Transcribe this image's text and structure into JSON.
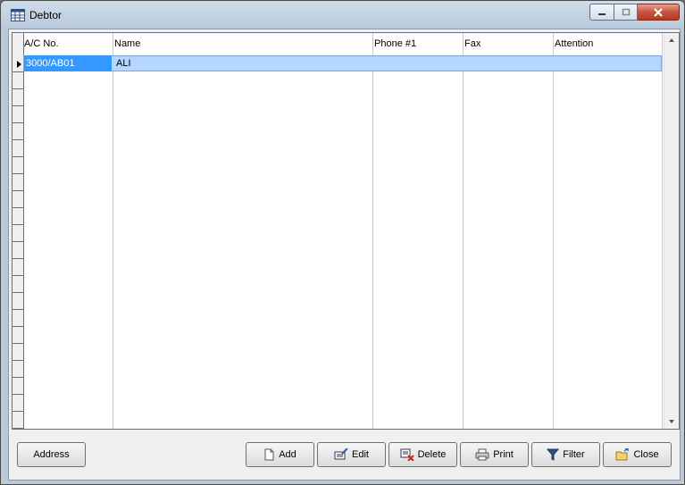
{
  "window": {
    "title": "Debtor"
  },
  "grid": {
    "columns": [
      "A/C No.",
      "Name",
      "Phone #1",
      "Fax",
      "Attention"
    ],
    "rows": [
      {
        "ac_no": "3000/AB01",
        "name": "ALI",
        "phone": "",
        "fax": "",
        "attention": ""
      }
    ]
  },
  "buttons": {
    "address": "Address",
    "add": "Add",
    "edit": "Edit",
    "delete": "Delete",
    "print": "Print",
    "filter": "Filter",
    "close": "Close"
  },
  "icons": {
    "app": "table-icon",
    "minimize": "minimize-icon",
    "maximize": "maximize-icon",
    "close": "close-icon",
    "add": "new-document-icon",
    "edit": "edit-icon",
    "delete": "delete-icon",
    "print": "printer-icon",
    "filter": "filter-icon",
    "exit": "exit-folder-icon"
  },
  "colors": {
    "selection": "#b5d7ff",
    "active_cell": "#3399ff",
    "close_button": "#c6543c"
  }
}
